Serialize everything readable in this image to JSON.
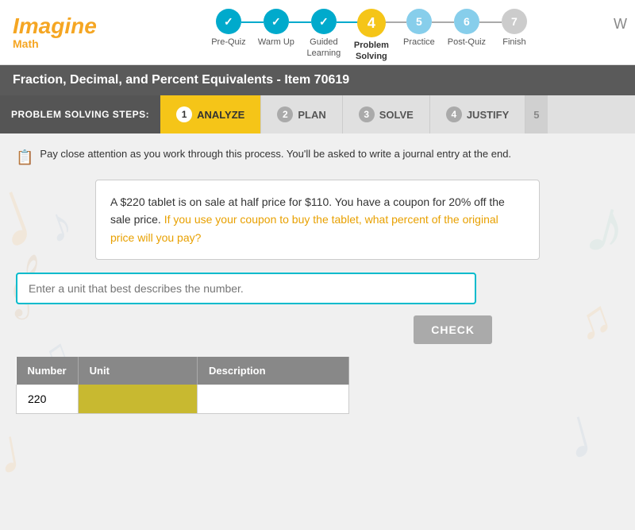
{
  "header": {
    "logo_imagine": "Imagine",
    "logo_math": "Math",
    "w_label": "W"
  },
  "steps": [
    {
      "id": 1,
      "label": "Pre-Quiz",
      "state": "completed",
      "num": "✓"
    },
    {
      "id": 2,
      "label": "Warm Up",
      "state": "completed",
      "num": "✓"
    },
    {
      "id": 3,
      "label": "Guided\nLearning",
      "state": "completed",
      "num": "✓"
    },
    {
      "id": 4,
      "label": "Problem\nSolving",
      "state": "active",
      "num": "4"
    },
    {
      "id": 5,
      "label": "Practice",
      "state": "light-blue",
      "num": "5"
    },
    {
      "id": 6,
      "label": "Post-Quiz",
      "state": "light-blue",
      "num": "6"
    },
    {
      "id": 7,
      "label": "Finish",
      "state": "upcoming",
      "num": "7"
    }
  ],
  "page_title": "Fraction, Decimal, and Percent Equivalents - Item 70619",
  "ps_label": "PROBLEM SOLVING STEPS:",
  "tabs": [
    {
      "id": 1,
      "label": "ANALYZE",
      "state": "active"
    },
    {
      "id": 2,
      "label": "PLAN",
      "state": "inactive"
    },
    {
      "id": 3,
      "label": "SOLVE",
      "state": "inactive"
    },
    {
      "id": 4,
      "label": "JUSTIFY",
      "state": "inactive"
    },
    {
      "id": 5,
      "label": "5",
      "state": "truncated"
    }
  ],
  "notice_text": "Pay close attention as you work through this process. You'll be asked to write a journal entry at the end.",
  "problem_text_1": "A $220 tablet is on sale at half price for $110. You have a coupon for 20% off the sale price.",
  "problem_text_highlighted": "If you use your coupon to buy the tablet, what percent of the original price will you pay?",
  "input_placeholder": "Enter a unit that best describes the number.",
  "check_button_label": "CHECK",
  "table": {
    "headers": [
      "Number",
      "Unit",
      "Description"
    ],
    "rows": [
      {
        "number": "220",
        "unit": "",
        "description": ""
      }
    ]
  }
}
